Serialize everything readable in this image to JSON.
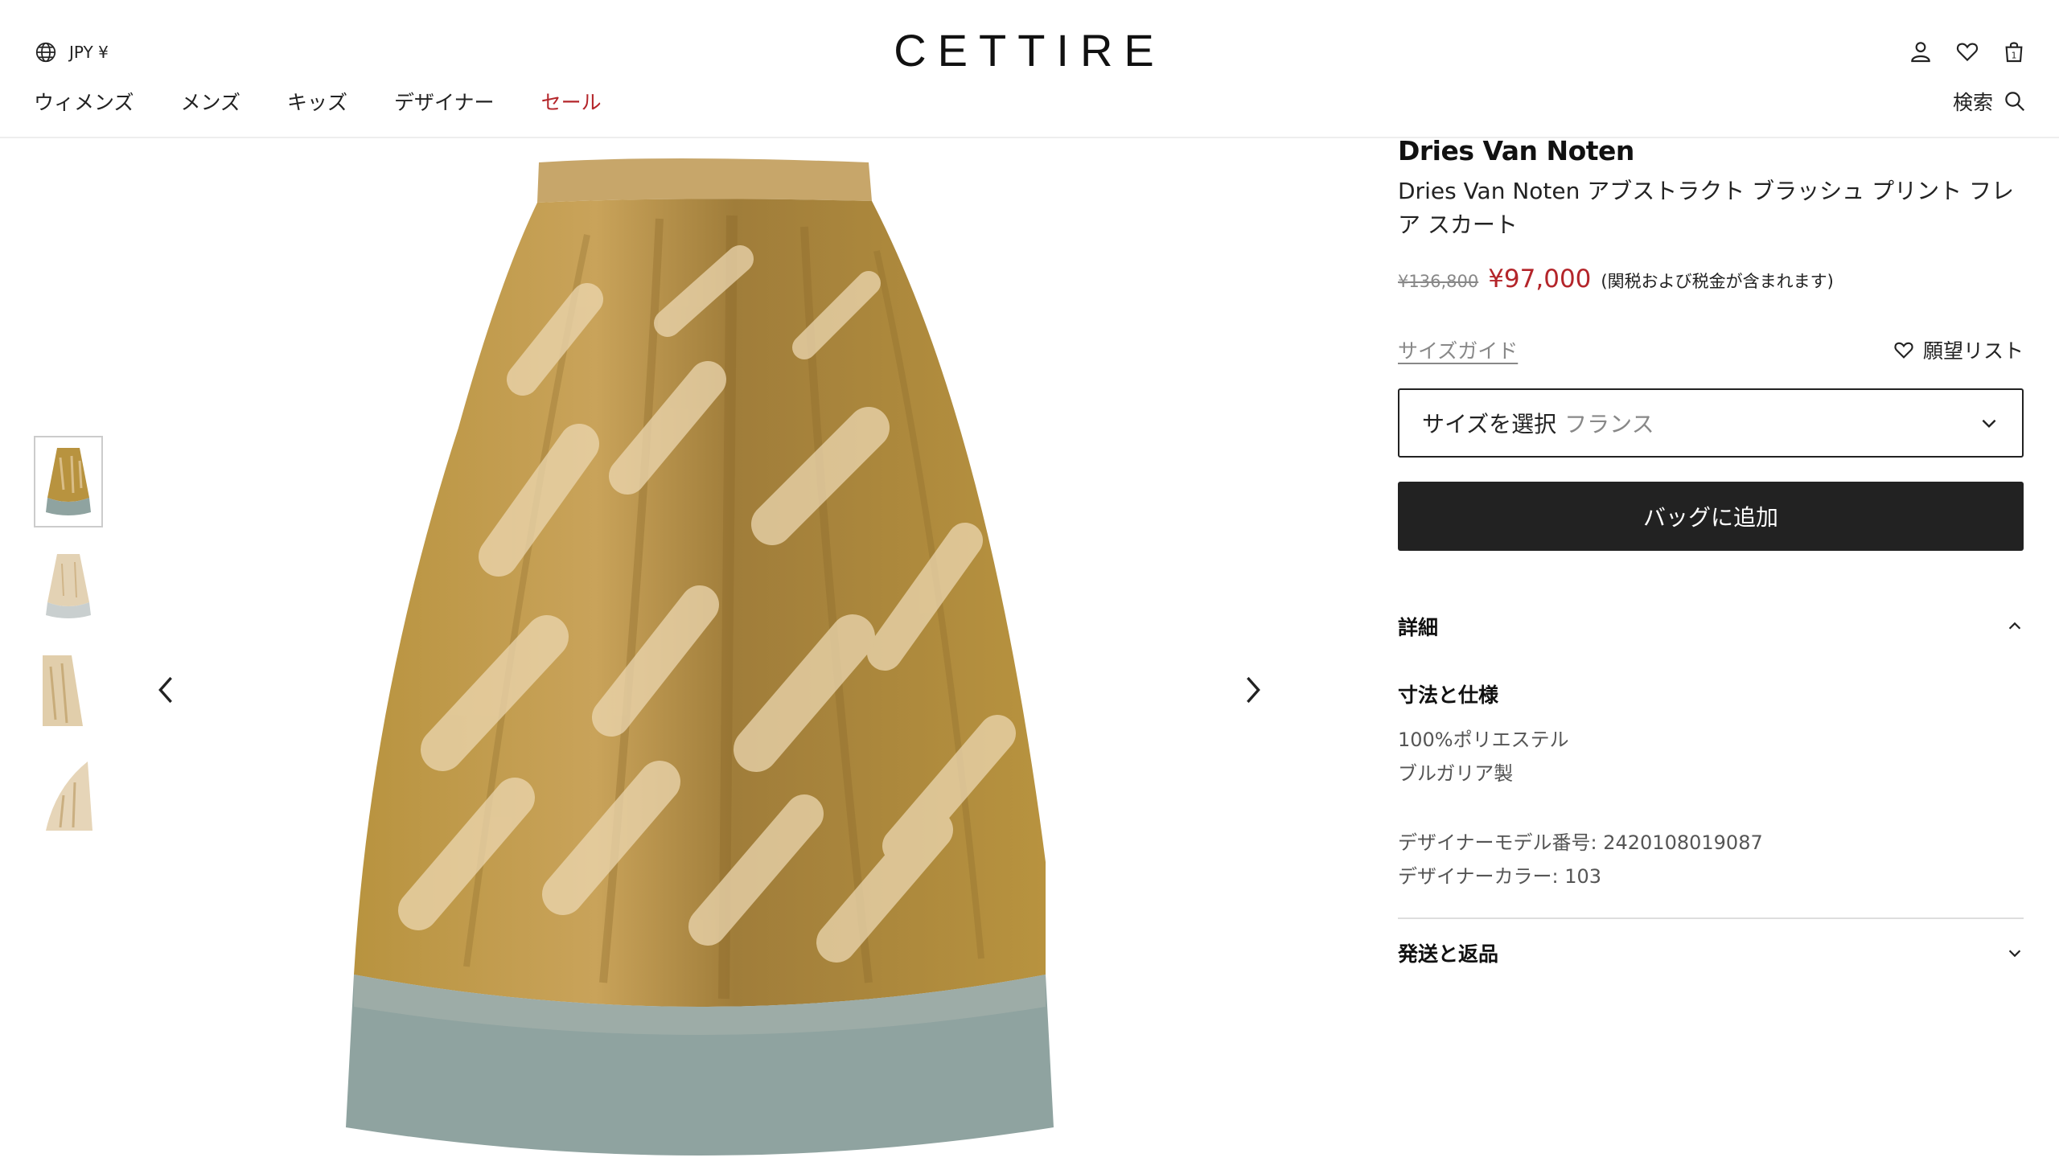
{
  "header": {
    "currency_label": "JPY ¥",
    "logo": "CETTIRE",
    "nav": [
      {
        "label": "ウィメンズ"
      },
      {
        "label": "メンズ"
      },
      {
        "label": "キッズ"
      },
      {
        "label": "デザイナー"
      },
      {
        "label": "セール"
      }
    ],
    "search_label": "検索",
    "bag_count": "1",
    "icons": [
      "globe-icon",
      "account-icon",
      "heart-icon",
      "bag-icon",
      "search-icon"
    ]
  },
  "gallery": {
    "thumbnail_count": 4,
    "active_index": 0
  },
  "product": {
    "brand": "Dries Van Noten",
    "name": "Dries Van Noten アブストラクト ブラッシュ プリント フレア スカート",
    "original_price": "¥136,800",
    "sale_price": "¥97,000",
    "tax_note": "(関税および税金が含まれます)",
    "size_guide": "サイズガイド",
    "wishlist": "願望リスト",
    "size_select": {
      "label": "サイズを選択",
      "sub": "フランス"
    },
    "add_to_bag": "バッグに追加",
    "details": {
      "heading": "詳細",
      "specs_title": "寸法と仕様",
      "lines": [
        "100%ポリエステル",
        "ブルガリア製"
      ],
      "model_no": "デザイナーモデル番号: 2420108019087",
      "color": "デザイナーカラー: 103"
    },
    "shipping_heading": "発送と返品"
  },
  "colors": {
    "sale_red": "#b4252a",
    "button_dark": "#222222",
    "skirt_ochre": "#b8933f",
    "skirt_hem": "#8fa3a0"
  }
}
